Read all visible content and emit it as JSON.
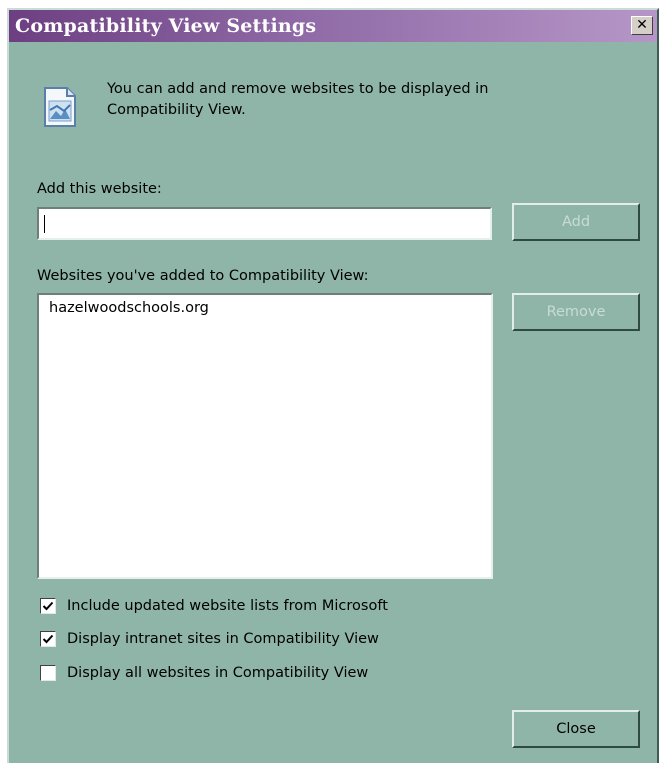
{
  "window": {
    "title": "Compatibility View Settings",
    "close_glyph": "✕"
  },
  "info": {
    "icon": "webpage-icon",
    "line1": "You can add and remove websites to be displayed in",
    "line2": "Compatibility View."
  },
  "add_section": {
    "label": "Add this website:",
    "input_value": "",
    "add_button": "Add"
  },
  "list_section": {
    "label": "Websites you've added to Compatibility View:",
    "items": [
      "hazelwoodschools.org"
    ],
    "remove_button": "Remove"
  },
  "options": [
    {
      "label": "Include updated website lists from Microsoft",
      "checked": true
    },
    {
      "label": "Display intranet sites in Compatibility View",
      "checked": true
    },
    {
      "label": "Display all websites in Compatibility View",
      "checked": false
    }
  ],
  "footer": {
    "close_button": "Close"
  },
  "colors": {
    "dialog_bg": "#8fb5a9",
    "title_start": "#6d3f82",
    "title_end": "#b696c7",
    "disabled_text": "#c8dcd5"
  }
}
